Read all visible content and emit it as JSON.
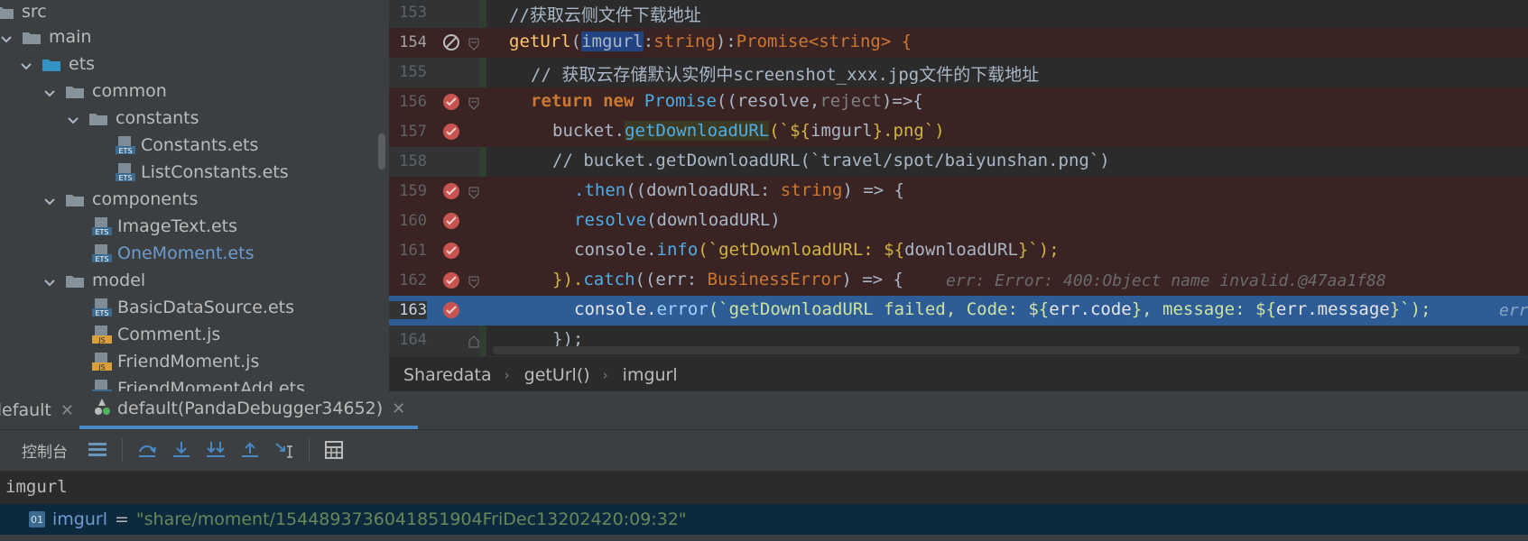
{
  "tree": {
    "items": [
      {
        "label": "src",
        "kind": "folder"
      },
      {
        "label": "main",
        "kind": "folder"
      },
      {
        "label": "ets",
        "kind": "folder-blue"
      },
      {
        "label": "common",
        "kind": "folder"
      },
      {
        "label": "constants",
        "kind": "folder"
      },
      {
        "label": "Constants.ets",
        "kind": "ets"
      },
      {
        "label": "ListConstants.ets",
        "kind": "ets"
      },
      {
        "label": "components",
        "kind": "folder"
      },
      {
        "label": "ImageText.ets",
        "kind": "ets"
      },
      {
        "label": "OneMoment.ets",
        "kind": "ets"
      },
      {
        "label": "model",
        "kind": "folder"
      },
      {
        "label": "BasicDataSource.ets",
        "kind": "ets"
      },
      {
        "label": "Comment.js",
        "kind": "js"
      },
      {
        "label": "FriendMoment.js",
        "kind": "js"
      },
      {
        "label": "FriendMomentAdd.ets",
        "kind": "ets"
      }
    ],
    "icon_labels": {
      "ets": "ETS",
      "js": "JS"
    }
  },
  "editor": {
    "line_numbers": [
      "153",
      "154",
      "155",
      "156",
      "157",
      "158",
      "159",
      "160",
      "161",
      "162",
      "163",
      "164"
    ],
    "lines": {
      "l153": "//获取云侧文件下载地址",
      "l154_fn": "getUrl",
      "l154_p1": "(",
      "l154_param": "imgurl",
      "l154_colon": ":",
      "l154_type": "string",
      "l154_p2": "):",
      "l154_ret": "Promise",
      "l154_gen": "<string>",
      "l154_brace": " {",
      "l155": "// 获取云存储默认实例中screenshot_xxx.jpg文件的下载地址",
      "l156_kw": "return new ",
      "l156_cls": "Promise",
      "l156_args": "((resolve,",
      "l156_rej": "reject",
      "l156_end": ")=>{",
      "l157_obj": "bucket.",
      "l157_fn": "getDownloadURL",
      "l157_a": "(`${",
      "l157_var": "imgurl",
      "l157_b": "}.png`)",
      "l158": "// bucket.getDownloadURL(`travel/spot/baiyunshan.png`)",
      "l159_then": ".then",
      "l159_a": "((downloadURL: ",
      "l159_type": "string",
      "l159_b": ") => {",
      "l160_fn": "resolve",
      "l160_a": "(downloadURL)",
      "l161_obj": "console.",
      "l161_fn": "info",
      "l161_a": "(`getDownloadURL: ${",
      "l161_var": "downloadURL",
      "l161_b": "}`);",
      "l162_a": "}).",
      "l162_catch": "catch",
      "l162_b": "((err: ",
      "l162_type": "BusinessError",
      "l162_c": ") => {",
      "l162_hint": "err: Error: 400:Object name invalid.@47aa1f88",
      "l163_obj": "console.",
      "l163_fn": "error",
      "l163_a": "(`getDownloadURL failed, Code: ${",
      "l163_v1": "err.code",
      "l163_b": "}, message: ${",
      "l163_v2": "err.message",
      "l163_c": "}`);",
      "l163_hint": "err",
      "l164": "});"
    }
  },
  "breadcrumb": {
    "items": [
      "Sharedata",
      "getUrl()",
      "imgurl"
    ]
  },
  "debug": {
    "tabs": [
      {
        "label": "default",
        "active": false
      },
      {
        "label": "default(PandaDebugger34652)",
        "active": true
      }
    ],
    "toolbar_label": "控制台",
    "watch_expression": "imgurl",
    "watch_result": {
      "icon": "01",
      "name": "imgurl",
      "eq": "=",
      "value": "\"share/moment/1544893736041851904FriDec13202420:09:32\""
    }
  },
  "colors": {
    "accent": "#4a88c7",
    "exec_line": "#2d5c97",
    "breakpoint": "#c75450"
  }
}
